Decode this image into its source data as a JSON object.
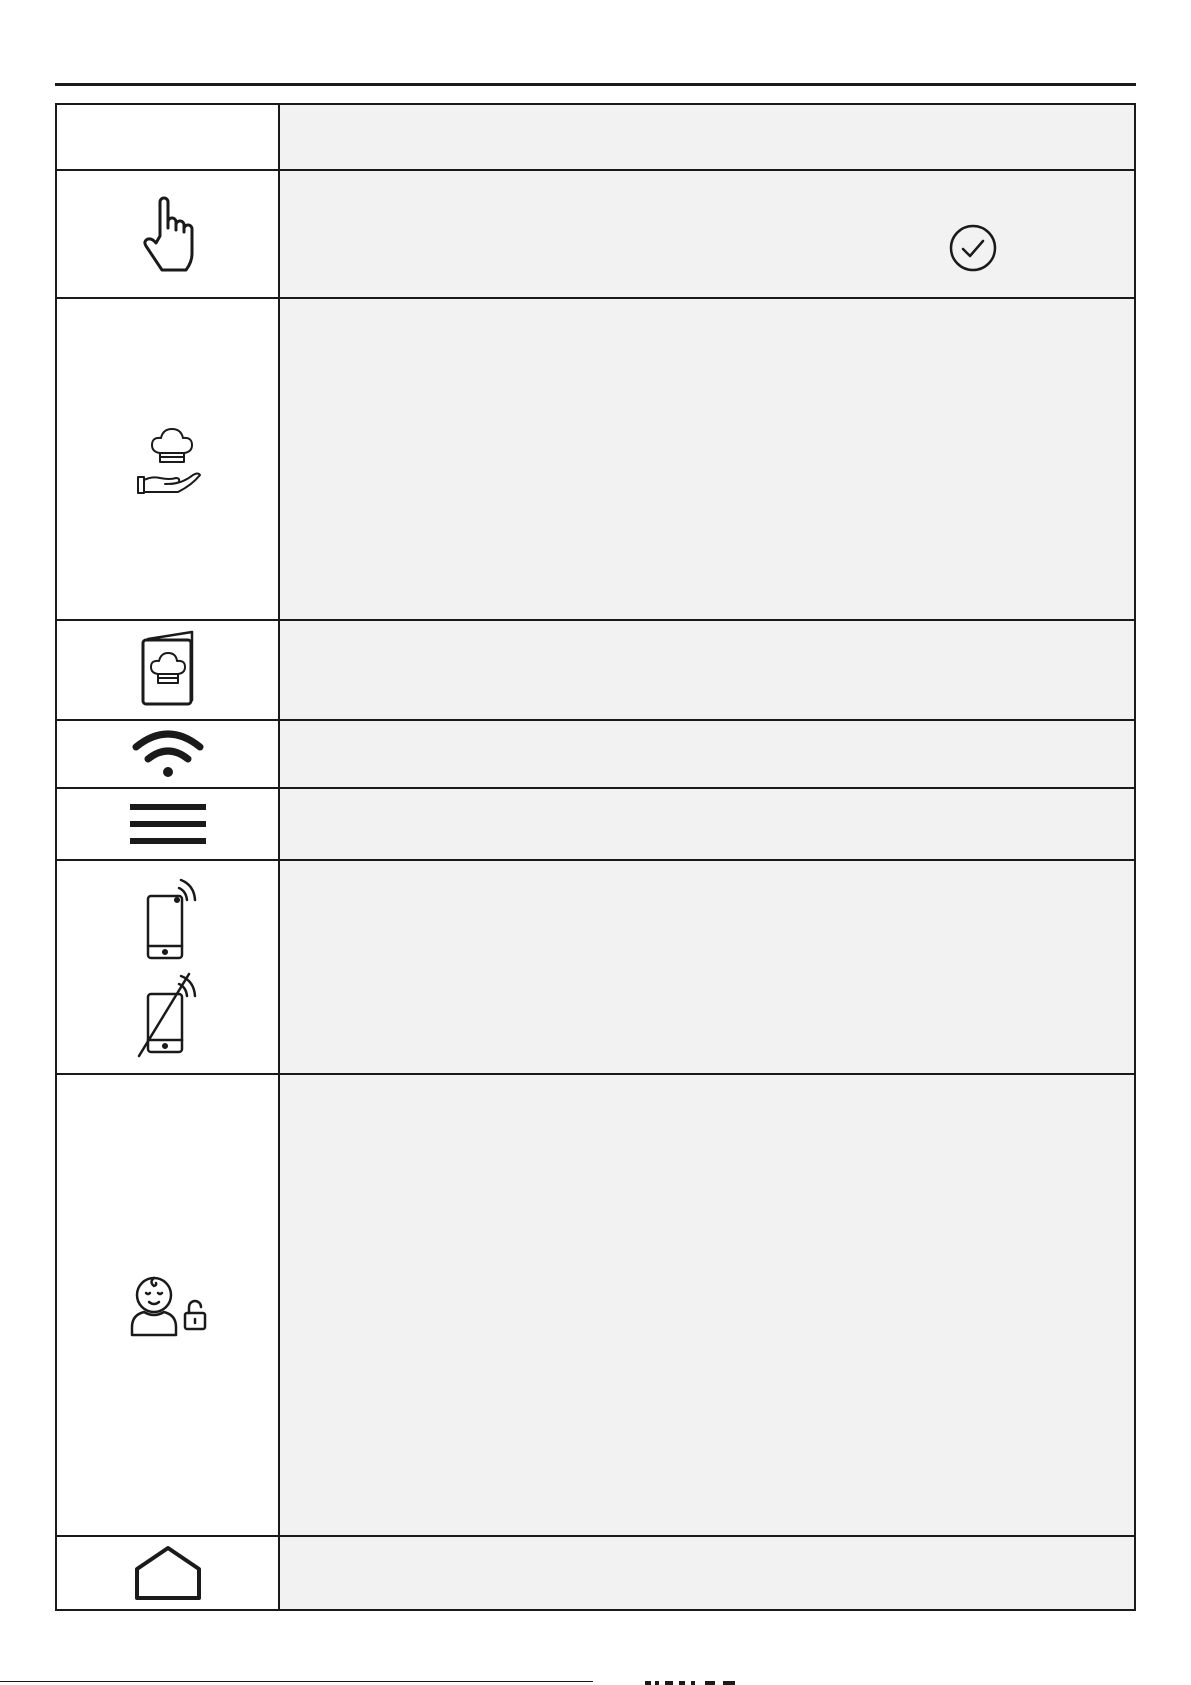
{
  "table": {
    "rows": [
      {
        "icon": "none",
        "text": ""
      },
      {
        "icon": "touch-hand-icon",
        "text": "",
        "extra_icon": "check-circle-icon"
      },
      {
        "icon": "chef-hat-hand-icon",
        "text": ""
      },
      {
        "icon": "recipe-book-icon",
        "text": ""
      },
      {
        "icon": "wifi-icon",
        "text": ""
      },
      {
        "icon": "menu-icon",
        "text": ""
      },
      {
        "icon": "smartphone-remote-icon",
        "text": "",
        "secondary_icon": "smartphone-remote-off-icon"
      },
      {
        "icon": "child-lock-icon",
        "text": ""
      },
      {
        "icon": "home-icon",
        "text": ""
      }
    ]
  },
  "colors": {
    "rule": "#1a1a1a",
    "text_cell_bg": "#f2f2f2",
    "icon_stroke": "#1a1a1a"
  }
}
